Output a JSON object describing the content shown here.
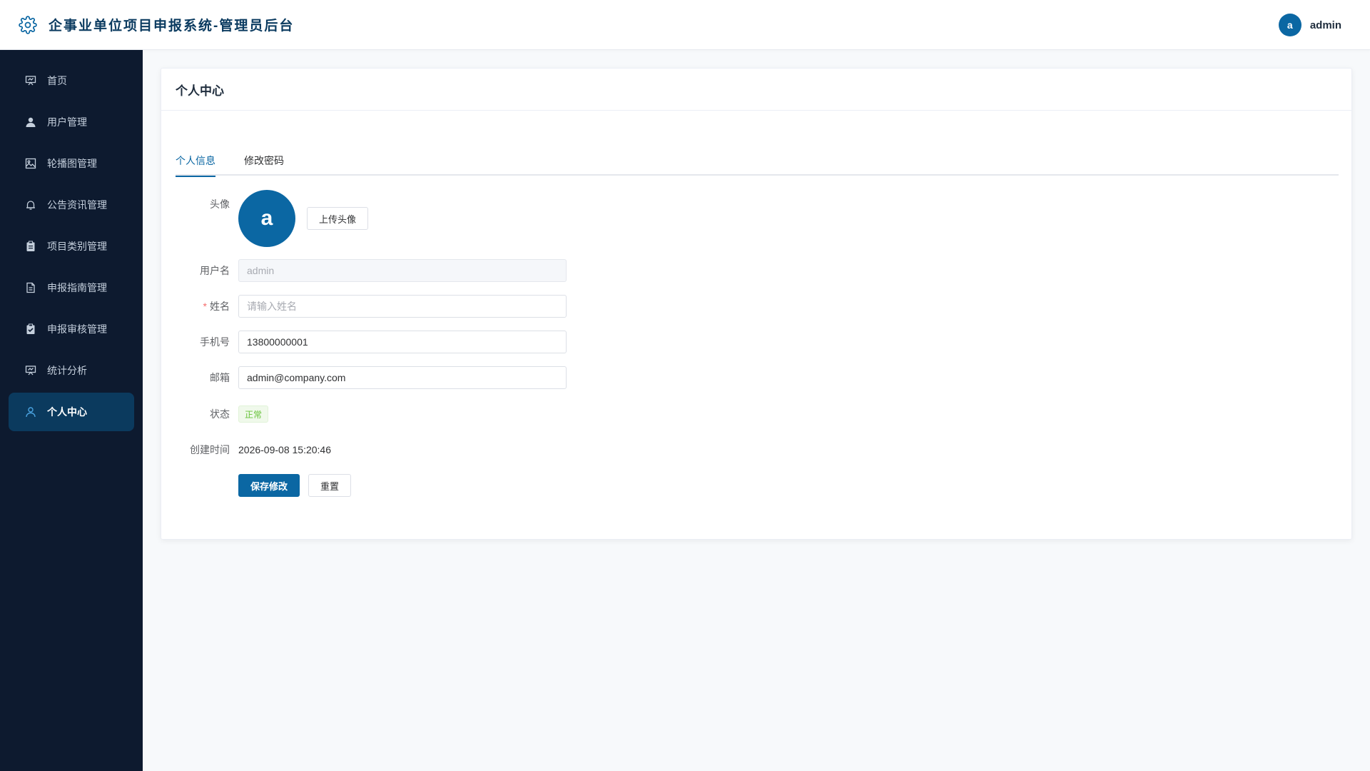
{
  "header": {
    "app_title": "企事业单位项目申报系统-管理员后台",
    "user_initial": "a",
    "username": "admin"
  },
  "sidebar": {
    "items": [
      {
        "label": "首页",
        "icon": "chart-board-icon"
      },
      {
        "label": "用户管理",
        "icon": "user-icon"
      },
      {
        "label": "轮播图管理",
        "icon": "image-icon"
      },
      {
        "label": "公告资讯管理",
        "icon": "bell-icon"
      },
      {
        "label": "项目类别管理",
        "icon": "clipboard-icon"
      },
      {
        "label": "申报指南管理",
        "icon": "document-icon"
      },
      {
        "label": "申报审核管理",
        "icon": "clipboard-check-icon"
      },
      {
        "label": "统计分析",
        "icon": "chart-board-icon"
      },
      {
        "label": "个人中心",
        "icon": "user-outline-icon",
        "active": true
      }
    ]
  },
  "main": {
    "card_title": "个人中心",
    "tabs": [
      {
        "label": "个人信息",
        "active": true
      },
      {
        "label": "修改密码",
        "active": false
      }
    ],
    "form": {
      "avatar_label": "头像",
      "avatar_initial": "a",
      "upload_button": "上传头像",
      "username_label": "用户名",
      "username_value": "admin",
      "name_label": "姓名",
      "name_required_mark": "*",
      "name_placeholder": "请输入姓名",
      "phone_label": "手机号",
      "phone_value": "13800000001",
      "email_label": "邮箱",
      "email_value": "admin@company.com",
      "status_label": "状态",
      "status_value": "正常",
      "created_label": "创建时间",
      "created_value": "2026-09-08 15:20:46",
      "save_button": "保存修改",
      "reset_button": "重置"
    }
  },
  "colors": {
    "primary": "#0b67a3",
    "sidebar_bg": "#0d1a2f",
    "sidebar_active": "#0b3a5e",
    "success": "#67c23a"
  }
}
